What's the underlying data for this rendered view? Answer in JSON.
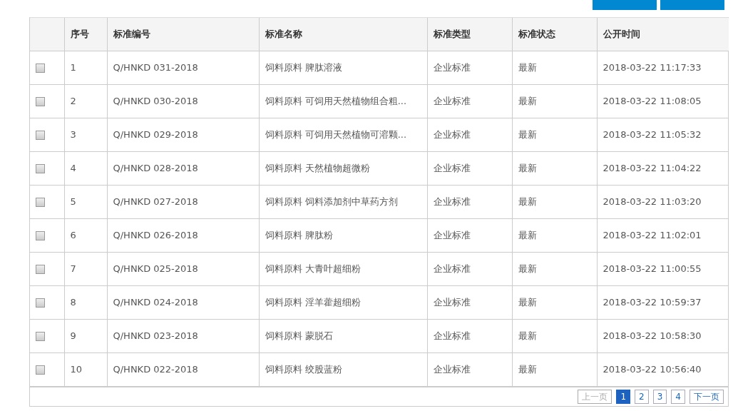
{
  "toolbar_buttons": [
    {
      "kind": "button"
    },
    {
      "kind": "button"
    }
  ],
  "table": {
    "columns": [
      "序号",
      "标准编号",
      "标准名称",
      "标准类型",
      "标准状态",
      "公开时间"
    ],
    "rows": [
      {
        "checked": false,
        "cells": [
          "1",
          "Q/HNKD 031-2018",
          "饲料原料 脾肽溶液",
          "企业标准",
          "最新",
          "2018-03-22 11:17:33"
        ]
      },
      {
        "checked": false,
        "cells": [
          "2",
          "Q/HNKD 030-2018",
          "饲料原料 可饲用天然植物组合粗...",
          "企业标准",
          "最新",
          "2018-03-22 11:08:05"
        ]
      },
      {
        "checked": false,
        "cells": [
          "3",
          "Q/HNKD 029-2018",
          "饲料原料 可饲用天然植物可溶颗...",
          "企业标准",
          "最新",
          "2018-03-22 11:05:32"
        ]
      },
      {
        "checked": false,
        "cells": [
          "4",
          "Q/HNKD 028-2018",
          "饲料原料 天然植物超微粉",
          "企业标准",
          "最新",
          "2018-03-22 11:04:22"
        ]
      },
      {
        "checked": false,
        "cells": [
          "5",
          "Q/HNKD 027-2018",
          "饲料原料 饲料添加剂中草药方剂",
          "企业标准",
          "最新",
          "2018-03-22 11:03:20"
        ]
      },
      {
        "checked": false,
        "cells": [
          "6",
          "Q/HNKD 026-2018",
          "饲料原料 脾肽粉",
          "企业标准",
          "最新",
          "2018-03-22 11:02:01"
        ]
      },
      {
        "checked": false,
        "cells": [
          "7",
          "Q/HNKD 025-2018",
          "饲料原料 大青叶超细粉",
          "企业标准",
          "最新",
          "2018-03-22 11:00:55"
        ]
      },
      {
        "checked": false,
        "cells": [
          "8",
          "Q/HNKD 024-2018",
          "饲料原料 淫羊藿超细粉",
          "企业标准",
          "最新",
          "2018-03-22 10:59:37"
        ]
      },
      {
        "checked": false,
        "cells": [
          "9",
          "Q/HNKD 023-2018",
          "饲料原料 蒙脱石",
          "企业标准",
          "最新",
          "2018-03-22 10:58:30"
        ]
      },
      {
        "checked": false,
        "cells": [
          "10",
          "Q/HNKD 022-2018",
          "饲料原料 绞股蓝粉",
          "企业标准",
          "最新",
          "2018-03-22 10:56:40"
        ]
      }
    ]
  },
  "pagination": {
    "prev": {
      "label": "上一页",
      "disabled": true
    },
    "pages": [
      {
        "label": "1",
        "selected": true
      },
      {
        "label": "2",
        "selected": false
      },
      {
        "label": "3",
        "selected": false
      },
      {
        "label": "4",
        "selected": false
      }
    ],
    "next": {
      "label": "下一页",
      "disabled": false
    }
  }
}
